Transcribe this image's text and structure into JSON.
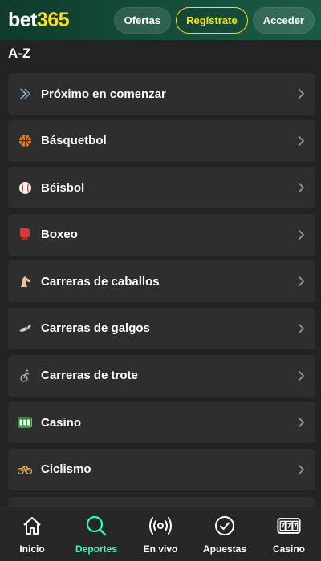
{
  "header": {
    "logo_white": "bet",
    "logo_yellow": "365",
    "offers_label": "Ofertas",
    "register_label": "Regístrate",
    "login_label": "Acceder"
  },
  "section": {
    "title": "A-Z"
  },
  "sports": [
    {
      "label": "Próximo en comenzar",
      "icon": "forward-arrows-icon"
    },
    {
      "label": "Básquetbol",
      "icon": "basketball-icon"
    },
    {
      "label": "Béisbol",
      "icon": "baseball-icon"
    },
    {
      "label": "Boxeo",
      "icon": "boxing-glove-icon"
    },
    {
      "label": "Carreras de caballos",
      "icon": "horse-icon"
    },
    {
      "label": "Carreras de galgos",
      "icon": "greyhound-icon"
    },
    {
      "label": "Carreras de trote",
      "icon": "harness-racing-icon"
    },
    {
      "label": "Casino",
      "icon": "slot-machine-icon"
    },
    {
      "label": "Ciclismo",
      "icon": "bicycle-icon"
    }
  ],
  "bottom_nav": [
    {
      "label": "Inicio",
      "icon": "home-icon",
      "active": false
    },
    {
      "label": "Deportes",
      "icon": "search-icon",
      "active": true
    },
    {
      "label": "En vivo",
      "icon": "live-broadcast-icon",
      "active": false
    },
    {
      "label": "Apuestas",
      "icon": "checkmark-circle-icon",
      "active": false
    },
    {
      "label": "Casino",
      "icon": "slots-777-icon",
      "active": false
    }
  ],
  "colors": {
    "brand_yellow": "#ffdf1b",
    "header_green": "#134a37",
    "active_nav": "#26ffbe",
    "background": "#232323",
    "row": "#2e2e2e"
  }
}
